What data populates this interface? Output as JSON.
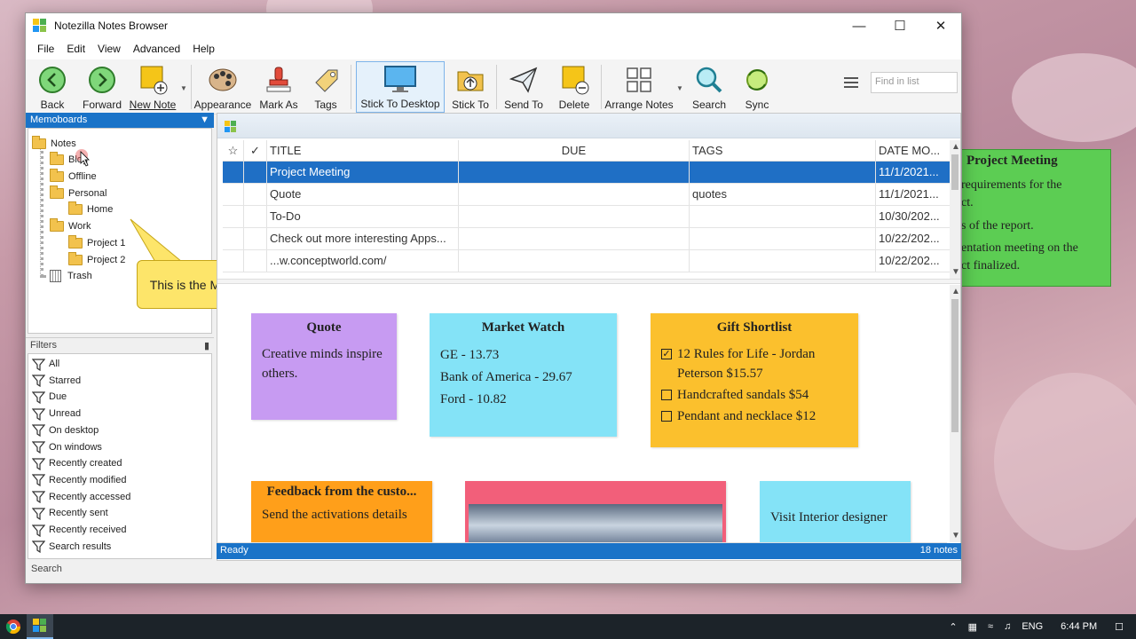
{
  "window": {
    "title": "Notezilla Notes Browser"
  },
  "menu": [
    "File",
    "Edit",
    "View",
    "Advanced",
    "Help"
  ],
  "toolbar": {
    "back": "Back",
    "forward": "Forward",
    "new_note": "New Note",
    "appearance": "Appearance",
    "mark_as": "Mark As",
    "tags": "Tags",
    "stick_to_desktop": "Stick To Desktop",
    "stick_to": "Stick To",
    "send_to": "Send To",
    "delete": "Delete",
    "arrange_notes": "Arrange Notes",
    "search": "Search",
    "sync": "Sync",
    "find_placeholder": "Find in list"
  },
  "memoboards": {
    "header": "Memoboards",
    "items": [
      "Notes",
      "Blog",
      "Offline",
      "Personal",
      "Home",
      "Work",
      "Project 1",
      "Project 2",
      "Trash"
    ]
  },
  "callout": {
    "text": "This is the Memoboards pane"
  },
  "filters": {
    "header": "Filters",
    "items": [
      "All",
      "Starred",
      "Due",
      "Unread",
      "On desktop",
      "On windows",
      "Recently created",
      "Recently modified",
      "Recently accessed",
      "Recently sent",
      "Recently received",
      "Search results"
    ],
    "search_tab": "Search"
  },
  "grid": {
    "columns": {
      "title": "TITLE",
      "due": "DUE",
      "tags": "TAGS",
      "date": "DATE MO..."
    },
    "rows": [
      {
        "title": "Project Meeting",
        "due": "",
        "tags": "",
        "date": "11/1/2021..."
      },
      {
        "title": "Quote",
        "due": "",
        "tags": "quotes",
        "date": "11/1/2021..."
      },
      {
        "title": "To-Do",
        "due": "",
        "tags": "",
        "date": "10/30/202..."
      },
      {
        "title": "Check out more interesting Apps...",
        "due": "",
        "tags": "",
        "date": "10/22/202..."
      },
      {
        "title": "...w.conceptworld.com/",
        "due": "",
        "tags": "",
        "date": "10/22/202..."
      }
    ]
  },
  "notes": {
    "quote": {
      "title": "Quote",
      "body": "Creative minds inspire others.",
      "color": "#c79bf2"
    },
    "market": {
      "title": "Market Watch",
      "lines": [
        "GE - 13.73",
        "Bank of America - 29.67",
        "Ford - 10.82"
      ],
      "color": "#84e3f7"
    },
    "gift": {
      "title": "Gift Shortlist",
      "items": [
        {
          "text": "12 Rules for Life - Jordan Peterson  $15.57",
          "checked": "✓"
        },
        {
          "text": "Handcrafted sandals  $54",
          "checked": ""
        },
        {
          "text": "Pendant and necklace  $12",
          "checked": ""
        }
      ],
      "color": "#fbc02d"
    },
    "feedback": {
      "title": "Feedback from the custo...",
      "body": "Send the activations details",
      "color": "#ff9f1a"
    },
    "interior": {
      "body": "Visit Interior designer",
      "color": "#84e3f7"
    },
    "photo_color": "#f25f7a"
  },
  "status": {
    "left": "Ready",
    "right": "18 notes"
  },
  "desktop_note": {
    "title": "Project Meeting",
    "lines": [
      "requirements for the",
      "ct.",
      "s of the report.",
      "entation meeting on the",
      "ct finalized."
    ]
  },
  "taskbar": {
    "lang": "ENG",
    "time": "6:44 PM"
  }
}
